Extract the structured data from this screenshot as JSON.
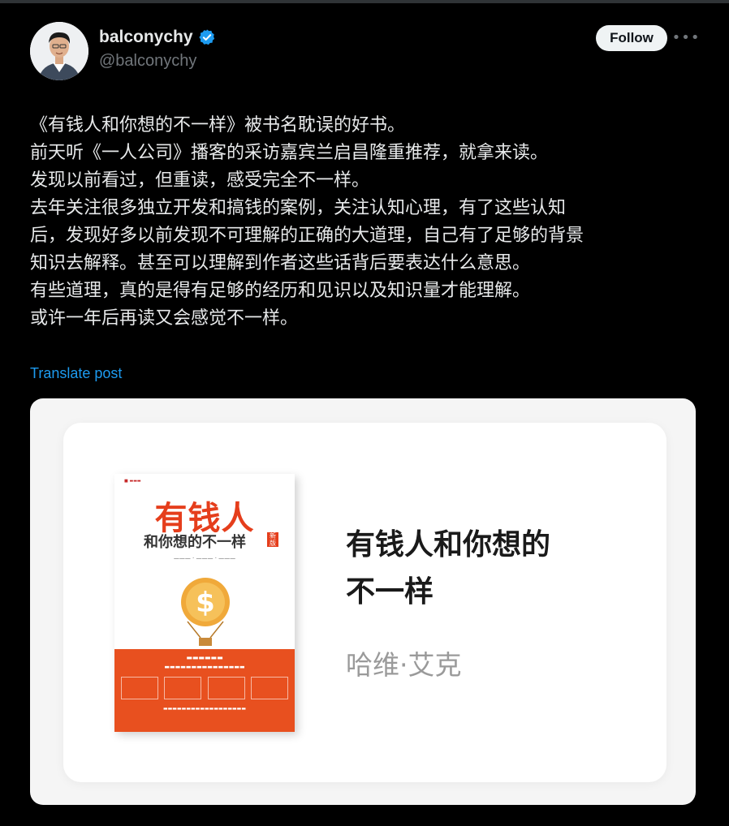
{
  "author": {
    "display_name": "balconychy",
    "handle": "@balconychy",
    "verified": true,
    "avatar_icon": "avatar-photo"
  },
  "actions": {
    "follow_label": "Follow",
    "more_icon": "more-horizontal-icon"
  },
  "post": {
    "lines": [
      "《有钱人和你想的不一样》被书名耽误的好书。",
      "前天听《一人公司》播客的采访嘉宾兰启昌隆重推荐，就拿来读。",
      "发现以前看过，但重读，感受完全不一样。",
      "去年关注很多独立开发和搞钱的案例，关注认知心理，有了这些认知",
      "后，发现好多以前发现不可理解的正确的大道理，自己有了足够的背景",
      "知识去解释。甚至可以理解到作者这些话背后要表达什么意思。",
      "有些道理，真的是得有足够的经历和见识以及知识量才能理解。",
      "或许一年后再读又会感觉不一样。"
    ],
    "translate_label": "Translate post"
  },
  "media": {
    "book_cover": {
      "title": "有钱人",
      "subtitle": "和你想的不一样",
      "badge": "新版"
    },
    "card_title_lines": [
      "有钱人和你想的",
      "不一样"
    ],
    "card_author": "哈维·艾克"
  },
  "colors": {
    "background": "#000000",
    "text": "#e7e9ea",
    "muted": "#71767b",
    "link": "#1d9bf0",
    "verified": "#1d9bf0",
    "book_red": "#e53e1c",
    "book_orange": "#e8501f"
  }
}
